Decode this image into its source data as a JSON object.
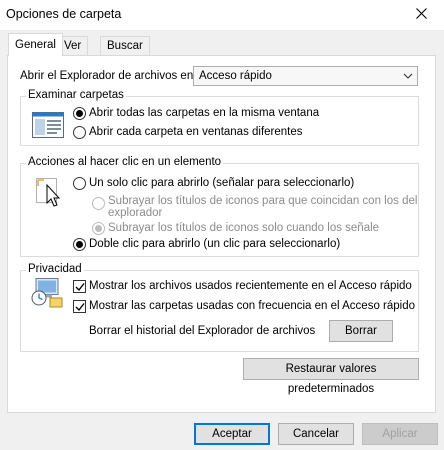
{
  "window": {
    "title": "Opciones de carpeta"
  },
  "tabs": [
    {
      "label": "General",
      "active": true
    },
    {
      "label": "Ver",
      "active": false
    },
    {
      "label": "Buscar",
      "active": false
    }
  ],
  "open_explorer": {
    "label": "Abrir el Explorador de archivos en:",
    "value": "Acceso rápido"
  },
  "browse_folders": {
    "title": "Examinar carpetas",
    "options": [
      {
        "label": "Abrir todas las carpetas en la misma ventana",
        "checked": true
      },
      {
        "label": "Abrir cada carpeta en ventanas diferentes",
        "checked": false
      }
    ]
  },
  "click_actions": {
    "title": "Acciones al hacer clic en un elemento",
    "single_click": {
      "label": "Un solo clic para abrirlo (señalar para seleccionarlo)",
      "checked": false
    },
    "underline_browser": {
      "label_line1": "Subrayar los títulos de iconos para que coincidan con los del",
      "label_line2": "explorador",
      "checked": false
    },
    "underline_hover": {
      "label": "Subrayar los títulos de iconos solo cuando los señale",
      "checked": true
    },
    "double_click": {
      "label": "Doble clic para abrirlo (un clic para seleccionarlo)",
      "checked": true
    }
  },
  "privacy": {
    "title": "Privacidad",
    "recent_files": {
      "label": "Mostrar los archivos usados recientemente en el Acceso rápido",
      "checked": true
    },
    "frequent_folders": {
      "label": "Mostrar las carpetas usadas con frecuencia en el Acceso rápido",
      "checked": true
    },
    "clear_history_label": "Borrar el historial del Explorador de archivos",
    "clear_button": "Borrar"
  },
  "restore_defaults": "Restaurar valores predeterminados",
  "footer": {
    "accept": "Aceptar",
    "cancel": "Cancelar",
    "apply": "Aplicar"
  },
  "icons": {
    "close": "close-icon",
    "window": "window-icon",
    "cursor": "cursor-icon",
    "privacy": "privacy-icon",
    "dropdown": "chevron-down-icon"
  },
  "colors": {
    "accent": "#0078d7",
    "dialog_bg": "#f0f0f0",
    "disabled_text": "#8c8c8c"
  }
}
